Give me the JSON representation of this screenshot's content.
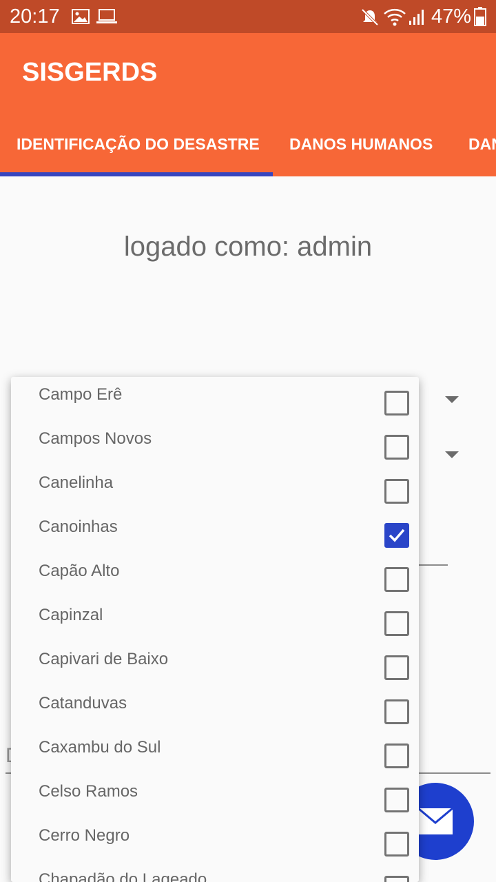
{
  "status_bar": {
    "time": "20:17",
    "battery": "47%",
    "icons": [
      "image-icon",
      "laptop-icon",
      "mute-icon",
      "wifi-icon",
      "signal-icon",
      "battery-icon"
    ]
  },
  "app_bar": {
    "title": "SISGERDS",
    "tabs": [
      {
        "label": "IDENTIFICAÇÃO DO DESASTRE",
        "selected": true
      },
      {
        "label": "DANOS HUMANOS",
        "selected": false
      },
      {
        "label": "DAN",
        "selected": false
      }
    ]
  },
  "main": {
    "logged_text": "logado como: admin",
    "hidden_field_letter": "D"
  },
  "popup": {
    "options": [
      {
        "label": "Campo Erê",
        "checked": false
      },
      {
        "label": "Campos Novos",
        "checked": false
      },
      {
        "label": "Canelinha",
        "checked": false
      },
      {
        "label": "Canoinhas",
        "checked": true
      },
      {
        "label": "Capão Alto",
        "checked": false
      },
      {
        "label": "Capinzal",
        "checked": false
      },
      {
        "label": "Capivari de Baixo",
        "checked": false
      },
      {
        "label": "Catanduvas",
        "checked": false
      },
      {
        "label": "Caxambu do Sul",
        "checked": false
      },
      {
        "label": "Celso Ramos",
        "checked": false
      },
      {
        "label": "Cerro Negro",
        "checked": false
      },
      {
        "label": "Chapadão do Lageado",
        "checked": false
      }
    ]
  },
  "colors": {
    "status_bar": "#bf4a28",
    "app_bar": "#f76737",
    "tab_indicator": "#3645bf",
    "checkbox_checked": "#2a45c8",
    "fab": "#1e3fce"
  }
}
